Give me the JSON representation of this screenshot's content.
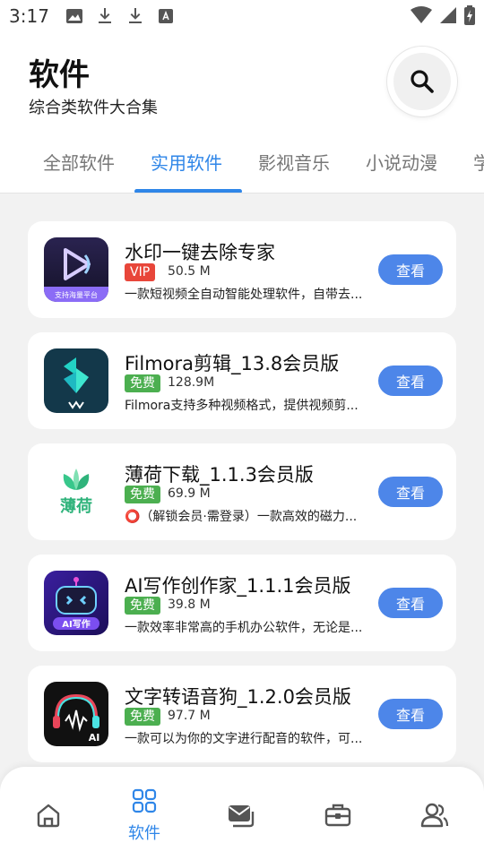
{
  "status": {
    "time": "3:17",
    "left_icons": [
      "image-icon",
      "download-icon",
      "download-icon",
      "font-icon"
    ],
    "right_icons": [
      "wifi-icon",
      "signal-icon",
      "battery-icon"
    ]
  },
  "header": {
    "title": "软件",
    "subtitle": "综合类软件大合集",
    "search_icon": "search-icon"
  },
  "tabs": [
    {
      "label": "全部软件",
      "active": false
    },
    {
      "label": "实用软件",
      "active": true
    },
    {
      "label": "影视音乐",
      "active": false
    },
    {
      "label": "小说动漫",
      "active": false
    },
    {
      "label": "学",
      "active": false
    }
  ],
  "apps": [
    {
      "title": "水印一键去除专家",
      "badge": "VIP",
      "badge_type": "vip",
      "size": "50.5 M",
      "desc": "一款短视频全自动智能处理软件，自带去...",
      "button": "查看",
      "icon_label": "支持海量平台"
    },
    {
      "title": "Filmora剪辑_13.8会员版",
      "badge": "免费",
      "badge_type": "free",
      "size": "128.9M",
      "desc": "Filmora支持多种视频格式，提供视频剪...",
      "button": "查看"
    },
    {
      "title": "薄荷下载_1.1.3会员版",
      "badge": "免费",
      "badge_type": "free",
      "size": "69.9 M",
      "desc": "⭕（解锁会员·需登录）一款高效的磁力...",
      "button": "查看",
      "icon_label": "薄荷"
    },
    {
      "title": "AI写作创作家_1.1.1会员版",
      "badge": "免费",
      "badge_type": "free",
      "size": "39.8 M",
      "desc": "一款效率非常高的手机办公软件，无论是...",
      "button": "查看",
      "icon_label": "AI写作"
    },
    {
      "title": "文字转语音狗_1.2.0会员版",
      "badge": "免费",
      "badge_type": "free",
      "size": "97.7 M",
      "desc": "一款可以为你的文字进行配音的软件，可...",
      "button": "查看",
      "icon_label": "AI"
    }
  ],
  "nav": {
    "items": [
      {
        "icon": "home-icon",
        "label": ""
      },
      {
        "icon": "apps-icon",
        "label": "软件"
      },
      {
        "icon": "mail-icon",
        "label": ""
      },
      {
        "icon": "toolbox-icon",
        "label": ""
      },
      {
        "icon": "users-icon",
        "label": ""
      }
    ]
  },
  "colors": {
    "accent": "#2f86e8",
    "button": "#4d86e9",
    "vip_badge": "#e8463a",
    "free_badge": "#4caf50"
  }
}
